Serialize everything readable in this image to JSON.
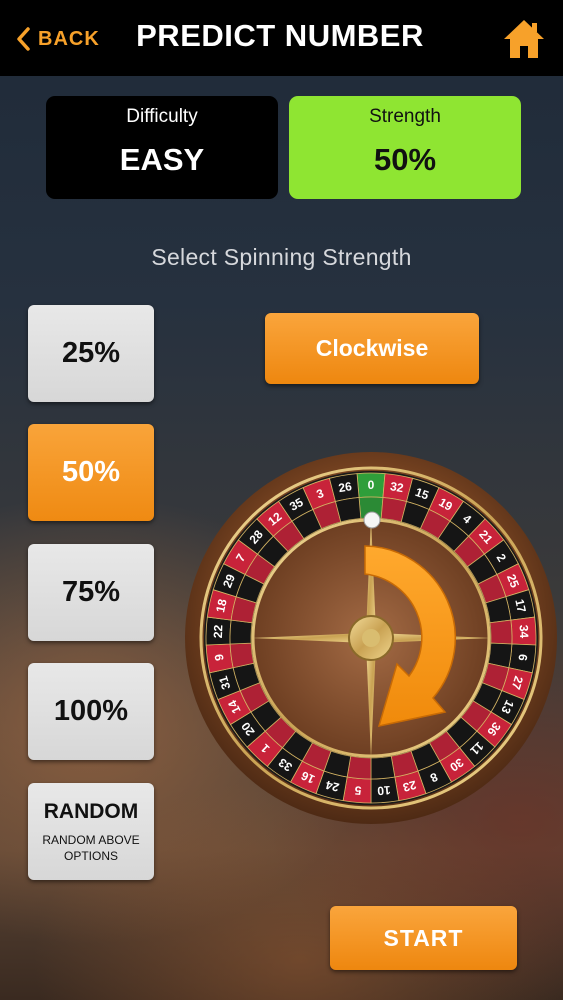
{
  "header": {
    "back_label": "BACK",
    "title": "PREDICT NUMBER",
    "home_icon": "home-icon",
    "accent_color": "#f7a12a"
  },
  "difficulty": {
    "label": "Difficulty",
    "value": "EASY"
  },
  "strength": {
    "label": "Strength",
    "value": "50%",
    "color": "#8fe532"
  },
  "prompt": "Select Spinning Strength",
  "options": [
    {
      "label": "25%",
      "selected": false
    },
    {
      "label": "50%",
      "selected": true
    },
    {
      "label": "75%",
      "selected": false
    },
    {
      "label": "100%",
      "selected": false
    },
    {
      "label": "RANDOM",
      "sublabel": "RANDOM ABOVE OPTIONS",
      "selected": false
    }
  ],
  "direction_button": "Clockwise",
  "start_button": "START",
  "wheel": {
    "numbers": [
      0,
      32,
      15,
      19,
      4,
      21,
      2,
      25,
      17,
      34,
      6,
      27,
      13,
      36,
      11,
      30,
      8,
      23,
      10,
      5,
      24,
      16,
      33,
      1,
      20,
      14,
      31,
      9,
      22,
      18,
      29,
      7,
      28,
      12,
      35,
      3,
      26
    ],
    "colors": {
      "red": "#c8233a",
      "black": "#151515",
      "green": "#2f9e3a"
    },
    "direction_arrow": "clockwise-arrow-icon"
  }
}
